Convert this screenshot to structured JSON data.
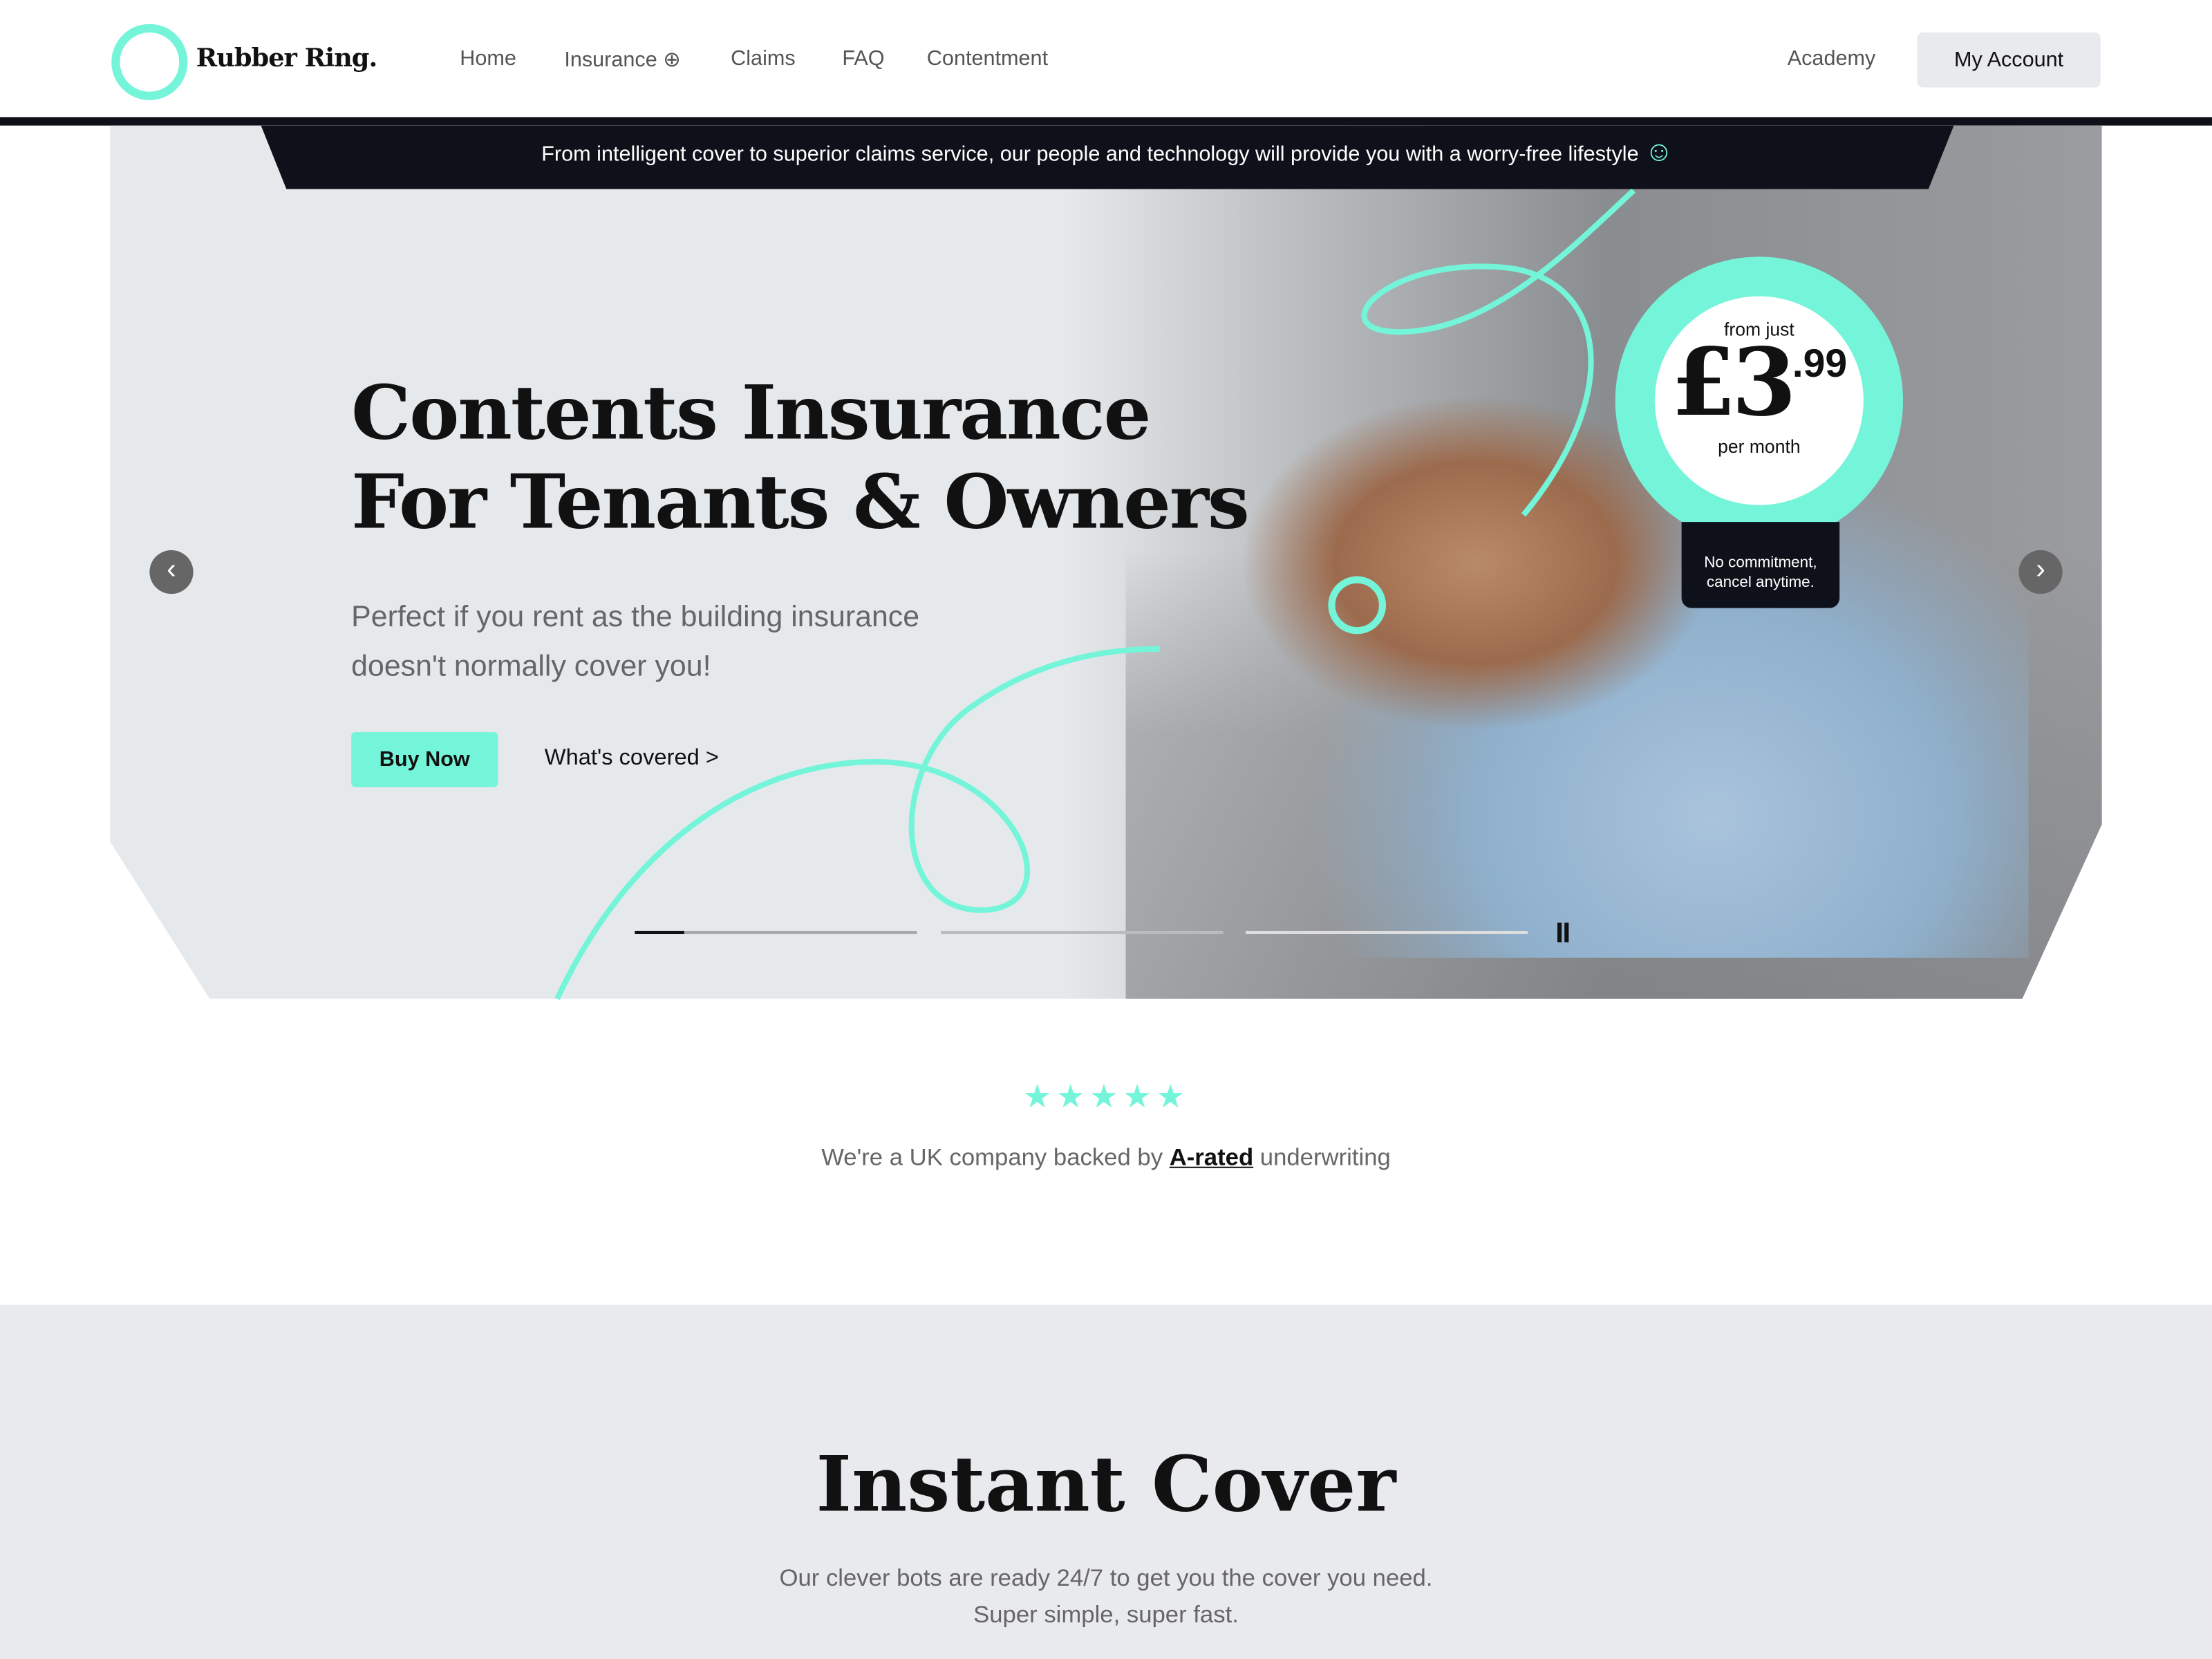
{
  "brand": {
    "name": "Rubber Ring.",
    "accent": "#74f5d9",
    "dark": "#0f111a"
  },
  "nav": {
    "items": [
      "Home",
      "Insurance",
      "Claims",
      "FAQ",
      "Contentment"
    ],
    "insurance_icon": "plus-circle-icon",
    "academy": "Academy",
    "account": "My Account"
  },
  "banner": {
    "text": "From intelligent cover to superior claims service, our people and technology will provide you with a worry-free lifestyle",
    "icon": "smiley-heart-icon"
  },
  "hero": {
    "title_line1": "Contents Insurance",
    "title_line2": "For Tenants & Owners",
    "subtitle_line1": "Perfect if you rent as the building insurance",
    "subtitle_line2": "doesn't normally cover you!",
    "buy": "Buy Now",
    "covered": "What's covered >",
    "prev": "‹",
    "next": "›"
  },
  "price": {
    "from": "from just",
    "amount": "£3",
    "pence": ".99",
    "period": "per month",
    "note_line1": "No commitment,",
    "note_line2": "cancel anytime."
  },
  "carousel": {
    "slides": 3,
    "active": 1,
    "pause_icon": "pause-icon"
  },
  "trust": {
    "stars": "★★★★★",
    "rating": 5,
    "before": "We're a UK company backed by ",
    "link": "A-rated",
    "after": " underwriting"
  },
  "instant": {
    "title": "Instant Cover",
    "line1": "Our clever bots are ready 24/7 to get you the cover you need.",
    "line2": "Super simple, super fast."
  }
}
